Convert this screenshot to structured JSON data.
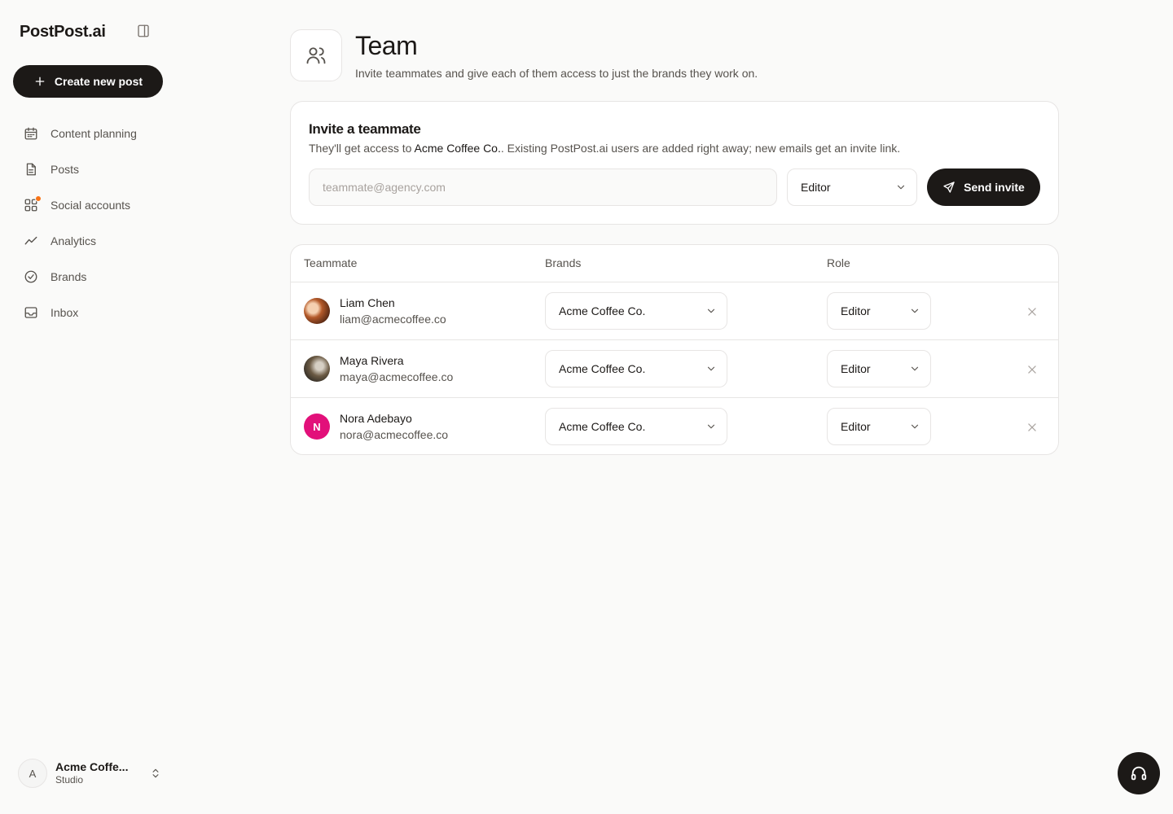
{
  "app": {
    "logo": "PostPost.ai",
    "create_label": "Create new post"
  },
  "nav": [
    {
      "label": "Content planning",
      "icon": "calendar-icon"
    },
    {
      "label": "Posts",
      "icon": "document-icon"
    },
    {
      "label": "Social accounts",
      "icon": "grid-icon",
      "badge": "notification-dot"
    },
    {
      "label": "Analytics",
      "icon": "trend-icon"
    },
    {
      "label": "Brands",
      "icon": "badge-check-icon"
    },
    {
      "label": "Inbox",
      "icon": "inbox-icon"
    }
  ],
  "workspace": {
    "initial": "A",
    "name": "Acme Coffe...",
    "plan": "Studio"
  },
  "page": {
    "title": "Team",
    "subtitle": "Invite teammates and give each of them access to just the brands they work on."
  },
  "invite": {
    "title": "Invite a teammate",
    "desc_prefix": "They'll get access to ",
    "desc_brand": "Acme Coffee Co.",
    "desc_suffix": ". Existing PostPost.ai users are added right away; new emails get an invite link.",
    "email_placeholder": "teammate@agency.com",
    "email_value": "",
    "role_value": "Editor",
    "send_label": "Send invite"
  },
  "table": {
    "headers": [
      "Teammate",
      "Brands",
      "Role"
    ],
    "rows": [
      {
        "name": "Liam Chen",
        "email": "liam@acmecoffee.co",
        "brand": "Acme Coffee Co.",
        "role": "Editor",
        "avatar": "photo"
      },
      {
        "name": "Maya Rivera",
        "email": "maya@acmecoffee.co",
        "brand": "Acme Coffee Co.",
        "role": "Editor",
        "avatar": "photo"
      },
      {
        "name": "Nora Adebayo",
        "email": "nora@acmecoffee.co",
        "brand": "Acme Coffee Co.",
        "role": "Editor",
        "avatar": "N"
      }
    ]
  },
  "colors": {
    "primary": "#1c1917",
    "background": "#fafaf9",
    "border": "#e7e5e4",
    "muted_text": "#57534e",
    "notification": "#f97316",
    "avatar_nora": "#e2107a"
  }
}
